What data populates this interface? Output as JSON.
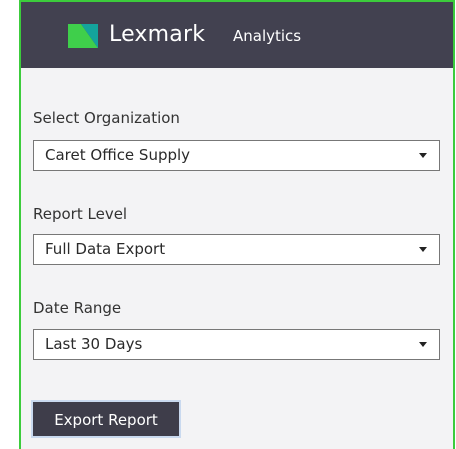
{
  "header": {
    "brand": "Lexmark",
    "app_name": "Analytics",
    "logo_icon": "lexmark-logo-icon",
    "logo_colors": [
      "#3fcf4b",
      "#14a39c"
    ]
  },
  "form": {
    "organization": {
      "label": "Select Organization",
      "value": "Caret Office Supply"
    },
    "report_level": {
      "label": "Report Level",
      "value": "Full Data Export"
    },
    "date_range": {
      "label": "Date Range",
      "value": "Last 30 Days"
    },
    "export_button": "Export Report"
  },
  "colors": {
    "header_bg": "#424150",
    "page_bg": "#f3f3f5",
    "frame_border": "#3ccc3c",
    "button_bg": "#3e3d4a"
  }
}
